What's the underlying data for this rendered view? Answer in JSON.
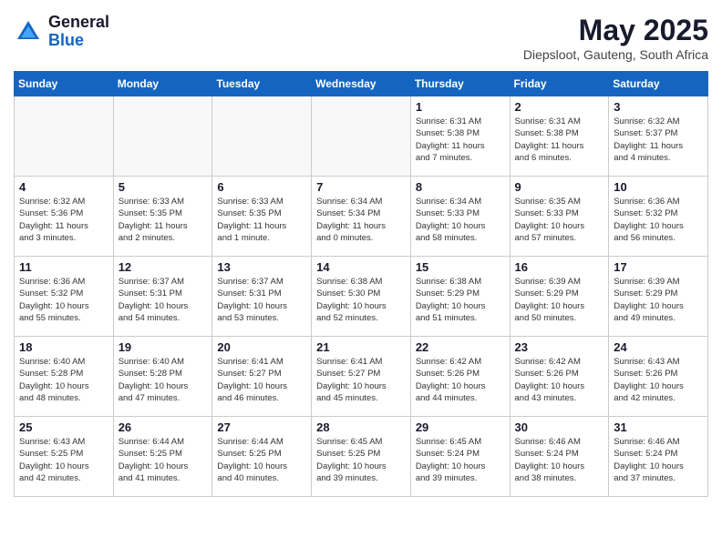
{
  "header": {
    "logo_line1": "General",
    "logo_line2": "Blue",
    "month": "May 2025",
    "location": "Diepsloot, Gauteng, South Africa"
  },
  "days_of_week": [
    "Sunday",
    "Monday",
    "Tuesday",
    "Wednesday",
    "Thursday",
    "Friday",
    "Saturday"
  ],
  "weeks": [
    [
      {
        "day": "",
        "info": ""
      },
      {
        "day": "",
        "info": ""
      },
      {
        "day": "",
        "info": ""
      },
      {
        "day": "",
        "info": ""
      },
      {
        "day": "1",
        "info": "Sunrise: 6:31 AM\nSunset: 5:38 PM\nDaylight: 11 hours\nand 7 minutes."
      },
      {
        "day": "2",
        "info": "Sunrise: 6:31 AM\nSunset: 5:38 PM\nDaylight: 11 hours\nand 6 minutes."
      },
      {
        "day": "3",
        "info": "Sunrise: 6:32 AM\nSunset: 5:37 PM\nDaylight: 11 hours\nand 4 minutes."
      }
    ],
    [
      {
        "day": "4",
        "info": "Sunrise: 6:32 AM\nSunset: 5:36 PM\nDaylight: 11 hours\nand 3 minutes."
      },
      {
        "day": "5",
        "info": "Sunrise: 6:33 AM\nSunset: 5:35 PM\nDaylight: 11 hours\nand 2 minutes."
      },
      {
        "day": "6",
        "info": "Sunrise: 6:33 AM\nSunset: 5:35 PM\nDaylight: 11 hours\nand 1 minute."
      },
      {
        "day": "7",
        "info": "Sunrise: 6:34 AM\nSunset: 5:34 PM\nDaylight: 11 hours\nand 0 minutes."
      },
      {
        "day": "8",
        "info": "Sunrise: 6:34 AM\nSunset: 5:33 PM\nDaylight: 10 hours\nand 58 minutes."
      },
      {
        "day": "9",
        "info": "Sunrise: 6:35 AM\nSunset: 5:33 PM\nDaylight: 10 hours\nand 57 minutes."
      },
      {
        "day": "10",
        "info": "Sunrise: 6:36 AM\nSunset: 5:32 PM\nDaylight: 10 hours\nand 56 minutes."
      }
    ],
    [
      {
        "day": "11",
        "info": "Sunrise: 6:36 AM\nSunset: 5:32 PM\nDaylight: 10 hours\nand 55 minutes."
      },
      {
        "day": "12",
        "info": "Sunrise: 6:37 AM\nSunset: 5:31 PM\nDaylight: 10 hours\nand 54 minutes."
      },
      {
        "day": "13",
        "info": "Sunrise: 6:37 AM\nSunset: 5:31 PM\nDaylight: 10 hours\nand 53 minutes."
      },
      {
        "day": "14",
        "info": "Sunrise: 6:38 AM\nSunset: 5:30 PM\nDaylight: 10 hours\nand 52 minutes."
      },
      {
        "day": "15",
        "info": "Sunrise: 6:38 AM\nSunset: 5:29 PM\nDaylight: 10 hours\nand 51 minutes."
      },
      {
        "day": "16",
        "info": "Sunrise: 6:39 AM\nSunset: 5:29 PM\nDaylight: 10 hours\nand 50 minutes."
      },
      {
        "day": "17",
        "info": "Sunrise: 6:39 AM\nSunset: 5:29 PM\nDaylight: 10 hours\nand 49 minutes."
      }
    ],
    [
      {
        "day": "18",
        "info": "Sunrise: 6:40 AM\nSunset: 5:28 PM\nDaylight: 10 hours\nand 48 minutes."
      },
      {
        "day": "19",
        "info": "Sunrise: 6:40 AM\nSunset: 5:28 PM\nDaylight: 10 hours\nand 47 minutes."
      },
      {
        "day": "20",
        "info": "Sunrise: 6:41 AM\nSunset: 5:27 PM\nDaylight: 10 hours\nand 46 minutes."
      },
      {
        "day": "21",
        "info": "Sunrise: 6:41 AM\nSunset: 5:27 PM\nDaylight: 10 hours\nand 45 minutes."
      },
      {
        "day": "22",
        "info": "Sunrise: 6:42 AM\nSunset: 5:26 PM\nDaylight: 10 hours\nand 44 minutes."
      },
      {
        "day": "23",
        "info": "Sunrise: 6:42 AM\nSunset: 5:26 PM\nDaylight: 10 hours\nand 43 minutes."
      },
      {
        "day": "24",
        "info": "Sunrise: 6:43 AM\nSunset: 5:26 PM\nDaylight: 10 hours\nand 42 minutes."
      }
    ],
    [
      {
        "day": "25",
        "info": "Sunrise: 6:43 AM\nSunset: 5:25 PM\nDaylight: 10 hours\nand 42 minutes."
      },
      {
        "day": "26",
        "info": "Sunrise: 6:44 AM\nSunset: 5:25 PM\nDaylight: 10 hours\nand 41 minutes."
      },
      {
        "day": "27",
        "info": "Sunrise: 6:44 AM\nSunset: 5:25 PM\nDaylight: 10 hours\nand 40 minutes."
      },
      {
        "day": "28",
        "info": "Sunrise: 6:45 AM\nSunset: 5:25 PM\nDaylight: 10 hours\nand 39 minutes."
      },
      {
        "day": "29",
        "info": "Sunrise: 6:45 AM\nSunset: 5:24 PM\nDaylight: 10 hours\nand 39 minutes."
      },
      {
        "day": "30",
        "info": "Sunrise: 6:46 AM\nSunset: 5:24 PM\nDaylight: 10 hours\nand 38 minutes."
      },
      {
        "day": "31",
        "info": "Sunrise: 6:46 AM\nSunset: 5:24 PM\nDaylight: 10 hours\nand 37 minutes."
      }
    ]
  ]
}
